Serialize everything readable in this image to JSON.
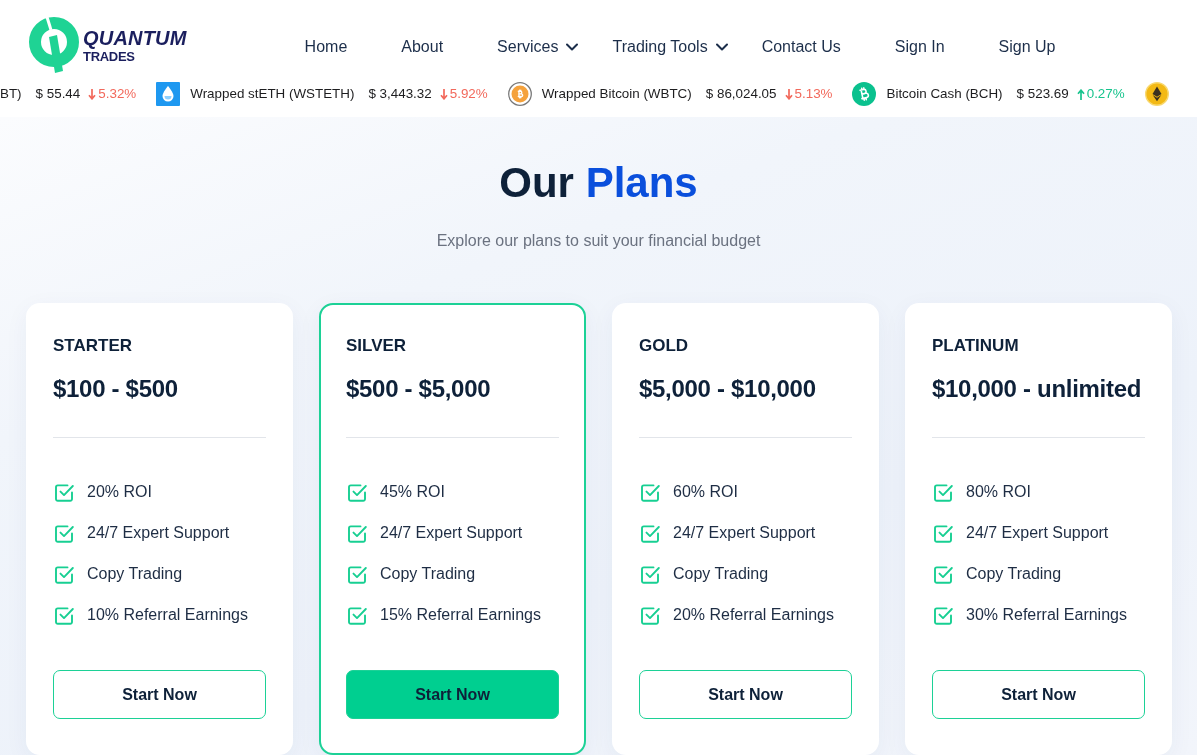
{
  "header": {
    "logo": {
      "line1": "QUANTUM",
      "line2": "TRADES"
    },
    "nav": [
      {
        "label": "Home",
        "has_menu": false
      },
      {
        "label": "About",
        "has_menu": false
      },
      {
        "label": "Services",
        "has_menu": true
      },
      {
        "label": "Trading Tools",
        "has_menu": true
      },
      {
        "label": "Contact Us",
        "has_menu": false
      },
      {
        "label": "Sign In",
        "has_menu": false
      },
      {
        "label": "Sign Up",
        "has_menu": false
      }
    ]
  },
  "ticker": [
    {
      "kind": "plain",
      "name": "BT)",
      "price": "$ 55.44",
      "change": "5.32%",
      "rising": false
    },
    {
      "kind": "droplet",
      "name": "Wrapped stETH (WSTETH)",
      "price": "$ 3,443.32",
      "change": "5.92%",
      "rising": false
    },
    {
      "kind": "ringcoin",
      "name": "Wrapped Bitcoin (WBTC)",
      "price": "$ 86,024.05",
      "change": "5.13%",
      "rising": false
    },
    {
      "kind": "greencoin",
      "name": "Bitcoin Cash (BCH)",
      "price": "$ 523.69",
      "change": "0.27%",
      "rising": true
    },
    {
      "kind": "diamond"
    }
  ],
  "plans_section": {
    "title_lead": "Our",
    "title_highlight": "Plans",
    "subtitle": "Explore our plans to suit your financial budget"
  },
  "plans": [
    {
      "name": "STARTER",
      "price": "$100 - $500",
      "highlighted": false,
      "features": [
        "20% ROI",
        "24/7 Expert Support",
        "Copy Trading",
        "10% Referral Earnings"
      ],
      "button": "Start Now"
    },
    {
      "name": "SILVER",
      "price": "$500 - $5,000",
      "highlighted": true,
      "features": [
        "45% ROI",
        "24/7 Expert Support",
        "Copy Trading",
        "15% Referral Earnings"
      ],
      "button": "Start Now"
    },
    {
      "name": "GOLD",
      "price": "$5,000 - $10,000",
      "highlighted": false,
      "features": [
        "60% ROI",
        "24/7 Expert Support",
        "Copy Trading",
        "20% Referral Earnings"
      ],
      "button": "Start Now"
    },
    {
      "name": "PLATINUM",
      "price": "$10,000 - unlimited",
      "highlighted": false,
      "features": [
        "80% ROI",
        "24/7 Expert Support",
        "Copy Trading",
        "30% Referral Earnings"
      ],
      "button": "Start Now"
    }
  ]
}
